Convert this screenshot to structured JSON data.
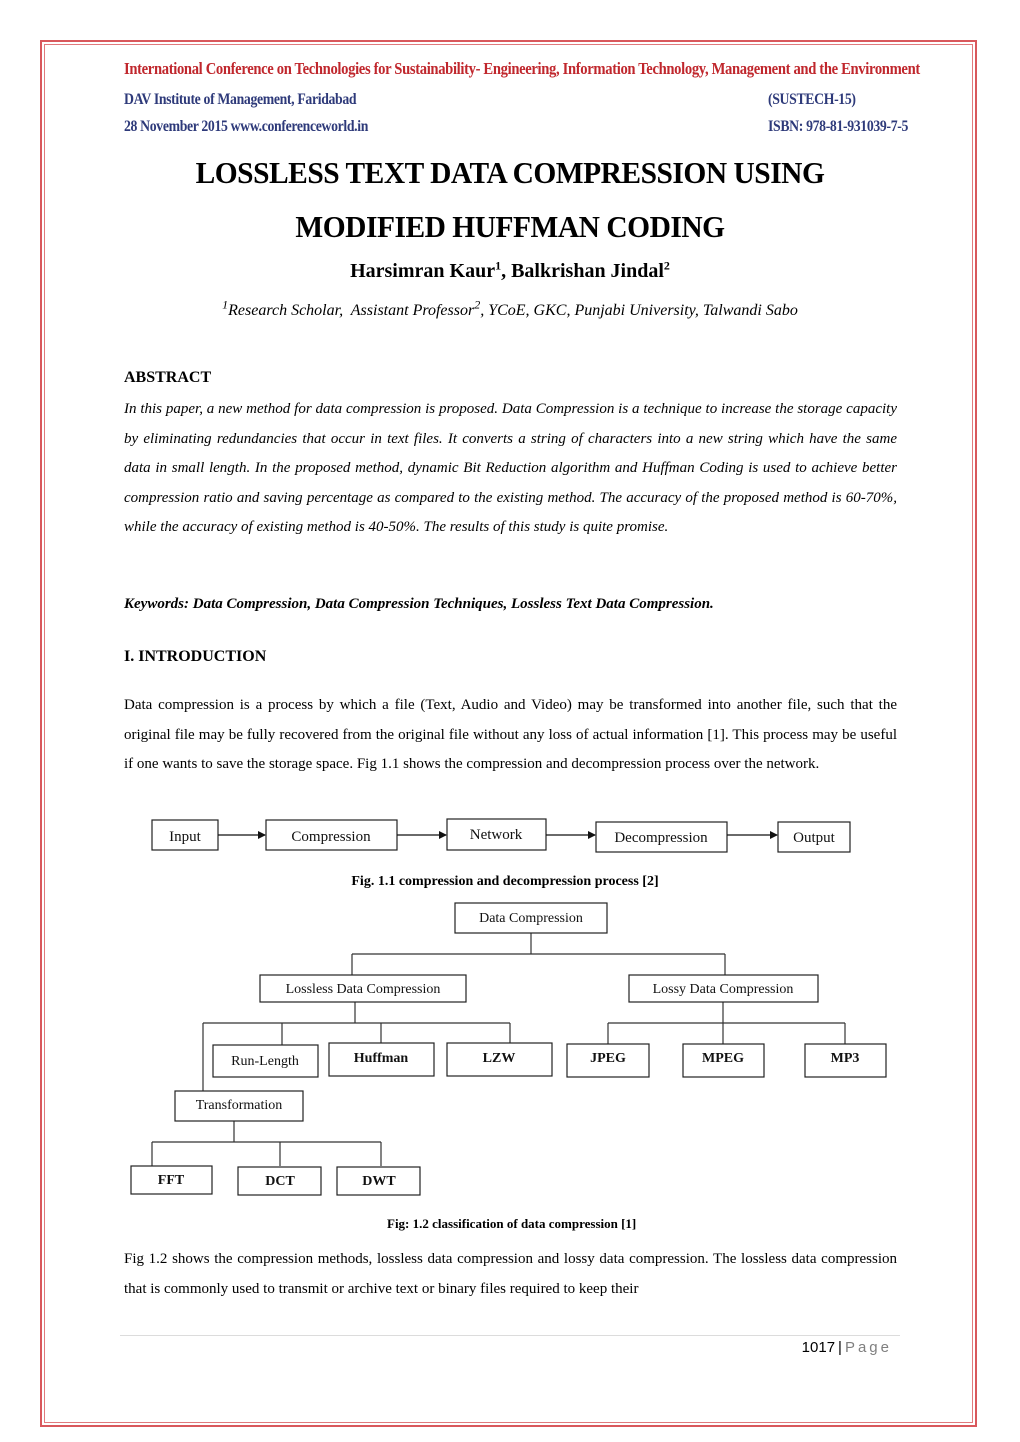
{
  "header": {
    "conference": "International Conference on Technologies for Sustainability- Engineering, Information Technology, Management and the Environment",
    "institute": "DAV Institute of Management, Faridabad",
    "date_site": "28 November 2015 www.conferenceworld.in",
    "event_code": "(SUSTECH-15)",
    "isbn": "ISBN: 978-81-931039-7-5"
  },
  "paper": {
    "title_line1": "LOSSLESS TEXT DATA COMPRESSION USING",
    "title_line2": "MODIFIED HUFFMAN CODING",
    "authors": [
      {
        "name": "Harsimran Kaur",
        "sup": "1"
      },
      {
        "name": "Balkrishan Jindal",
        "sup": "2"
      }
    ],
    "author_sep": ", ",
    "affiliation": {
      "sup1": "1",
      "part1": "Research Scholar,  Assistant Professor",
      "sup2": "2",
      "part2": ", YCoE, GKC, Punjabi University, Talwandi Sabo"
    }
  },
  "abstract": {
    "heading": "ABSTRACT",
    "text": "In this paper, a new method for data compression is proposed. Data Compression is a technique to increase the storage capacity by eliminating redundancies that occur in text files. It converts a string of characters into a new string which have the same data in small length. In the proposed method, dynamic Bit Reduction algorithm and Huffman Coding is used to achieve better compression ratio and saving percentage as compared to the existing method. The accuracy of the proposed method is 60-70%, while the accuracy of existing method is 40-50%. The results of this study is quite promise."
  },
  "keywords": "Keywords: Data Compression, Data Compression Techniques, Lossless Text Data Compression.",
  "introduction": {
    "heading": "I. INTRODUCTION",
    "paragraph1": "Data compression is a process by which a file (Text, Audio and Video) may be transformed into another file, such that the original file may be fully recovered from the original file without any loss of actual information [1]. This process may be useful if one wants to save the storage space. Fig 1.1 shows the compression and decompression process over the network.",
    "paragraph2": "Fig 1.2 shows the compression methods, lossless data compression and lossy data compression. The lossless data compression that is commonly used to transmit or archive text or binary files required to keep their"
  },
  "figure1": {
    "caption": "Fig. 1.1 compression and decompression process [2]",
    "nodes": [
      "Input",
      "Compression",
      "Network",
      "Decompression",
      "Output"
    ]
  },
  "figure2": {
    "caption": "Fig: 1.2 classification of data compression [1]",
    "root": "Data Compression",
    "lossless": {
      "label": "Lossless Data Compression",
      "children": [
        "Run-Length",
        "Huffman",
        "LZW"
      ],
      "transformation": {
        "label": "Transformation",
        "children": [
          "FFT",
          "DCT",
          "DWT"
        ]
      }
    },
    "lossy": {
      "label": "Lossy Data Compression",
      "children": [
        "JPEG",
        "MPEG",
        "MP3"
      ]
    }
  },
  "footer": {
    "page_number": "1017",
    "separator": "|",
    "page_word": "Page"
  },
  "colors": {
    "border": "#d9585c",
    "conference_title": "#c0272d",
    "header_blue": "#2e3a7a"
  }
}
